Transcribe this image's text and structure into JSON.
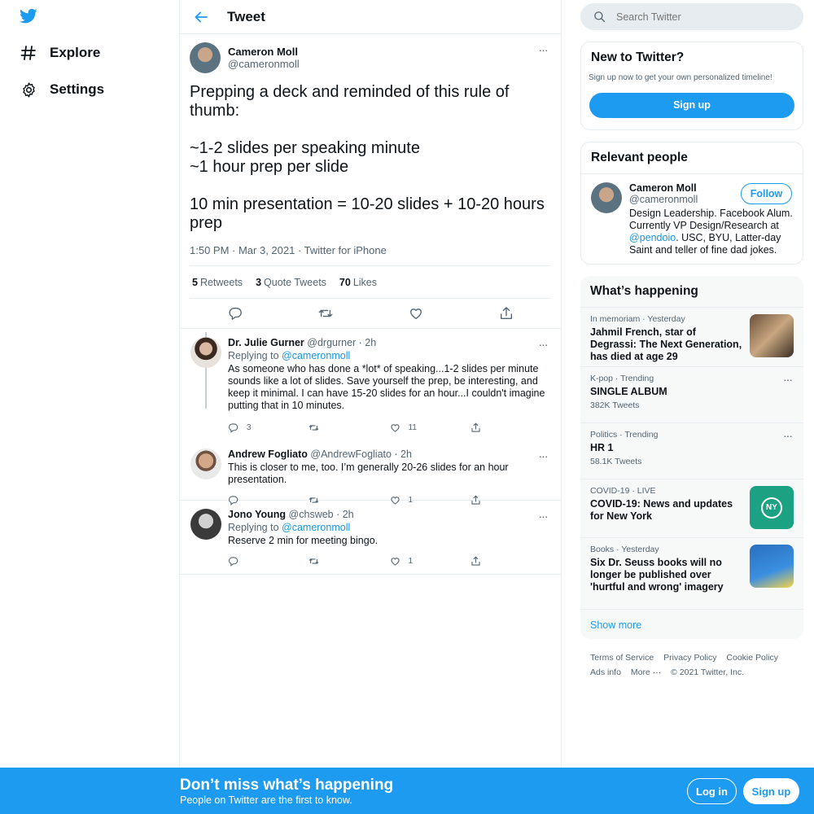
{
  "nav": {
    "explore_label": "Explore",
    "settings_label": "Settings"
  },
  "header": {
    "title": "Tweet"
  },
  "main_tweet": {
    "name": "Cameron Moll",
    "handle": "@cameronmoll",
    "text": "Prepping a deck and reminded of this rule of thumb:\n\n~1-2 slides per speaking minute\n~1 hour prep per slide\n\n10 min presentation = 10-20 slides + 10-20 hours prep",
    "meta": "1:50 PM · Mar 3, 2021 · Twitter for iPhone",
    "retweets_count": "5",
    "retweets_label": "Retweets",
    "quotes_count": "3",
    "quotes_label": "Quote Tweets",
    "likes_count": "70",
    "likes_label": "Likes"
  },
  "replies": [
    {
      "name": "Dr. Julie Gurner",
      "handle_time": "@drgurner · 2h",
      "replying_prefix": "Replying to ",
      "replying_to": "@cameronmoll",
      "text": "As someone who has done a *lot* of speaking...1-2 slides per minute sounds like a lot of slides. Save yourself the prep, be interesting, and keep it minimal. I can have 15-20 slides for an hour...I couldn't imagine putting that in 10 minutes.",
      "reply_count": "3",
      "retweet_count": "",
      "like_count": "11"
    },
    {
      "name": "Andrew Fogliato",
      "handle_time": "@AndrewFogliato · 2h",
      "text": "This is closer to me, too. I’m generally 20-26 slides for an hour presentation.",
      "reply_count": "",
      "retweet_count": "",
      "like_count": "1"
    },
    {
      "name": "Jono Young",
      "handle_time": "@chsweb · 2h",
      "replying_prefix": "Replying to ",
      "replying_to": "@cameronmoll",
      "text": "Reserve 2 min for meeting bingo.",
      "reply_count": "",
      "retweet_count": "",
      "like_count": "1"
    }
  ],
  "search": {
    "placeholder": "Search Twitter"
  },
  "new_to_twitter": {
    "title": "New to Twitter?",
    "subtitle": "Sign up now to get your own personalized timeline!",
    "signup_label": "Sign up"
  },
  "relevant_people": {
    "title": "Relevant people",
    "name": "Cameron Moll",
    "handle": "@cameronmoll",
    "follow_label": "Follow",
    "bio_pre": "Design Leadership. Facebook Alum. Currently VP Design/Research at ",
    "bio_link": "@pendoio",
    "bio_post": ". USC, BYU, Latter-day Saint and teller of fine dad jokes."
  },
  "whats_happening": {
    "title": "What’s happening",
    "trends": [
      {
        "context": "In memoriam · Yesterday",
        "title": "Jahmil French, star of Degrassi: The Next Generation, has died at age 29",
        "count": ""
      },
      {
        "context": "K-pop · Trending",
        "title": "SINGLE ALBUM",
        "count": "382K Tweets"
      },
      {
        "context": "Politics · Trending",
        "title": "HR 1",
        "count": "58.1K Tweets"
      },
      {
        "context": "COVID-19 · LIVE",
        "title": "COVID-19: News and updates for New York",
        "count": "",
        "badge": "NY"
      },
      {
        "context": "Books · Yesterday",
        "title": "Six Dr. Seuss books will no longer be published over 'hurtful and wrong' imagery",
        "count": ""
      }
    ],
    "show_more": "Show more"
  },
  "footer": {
    "terms": "Terms of Service",
    "privacy": "Privacy Policy",
    "cookie": "Cookie Policy",
    "ads": "Ads info",
    "more": "More ···",
    "copyright": "© 2021 Twitter, Inc."
  },
  "bottom_bar": {
    "title": "Don’t miss what’s happening",
    "subtitle": "People on Twitter are the first to know.",
    "login_label": "Log in",
    "signup_label": "Sign up"
  },
  "colors": {
    "accent": "#1d9bf0",
    "text": "#0f1419",
    "secondary": "#536471",
    "border": "#e6ecf0"
  }
}
